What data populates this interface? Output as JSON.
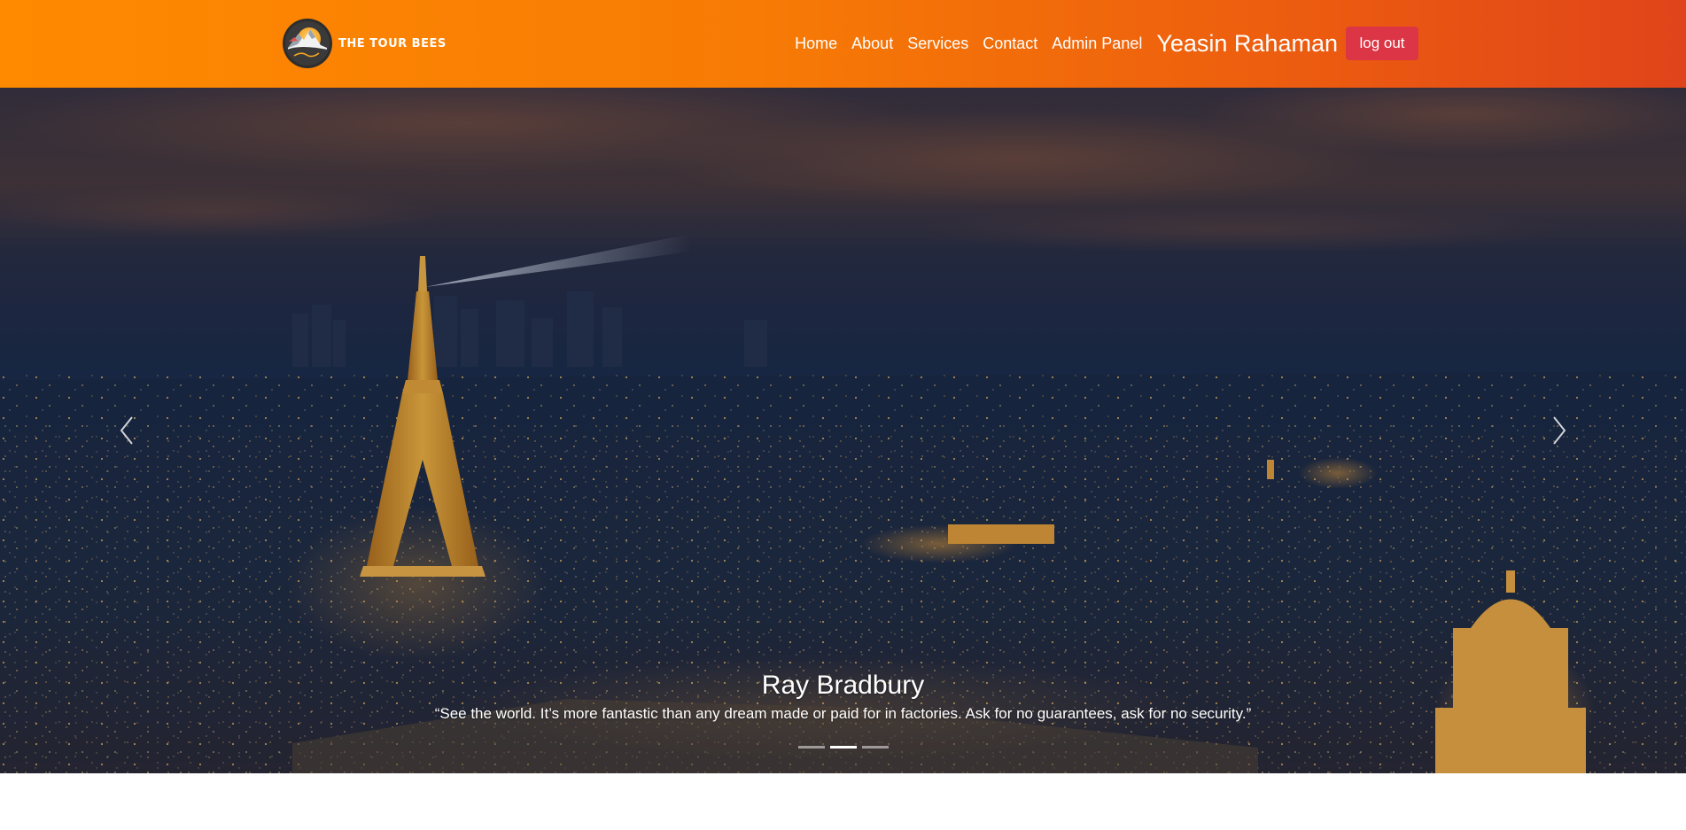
{
  "navbar": {
    "brand_name": "THE TOUR BEES",
    "links": [
      "Home",
      "About",
      "Services",
      "Contact",
      "Admin Panel"
    ],
    "user_name": "Yeasin Rahaman",
    "logout_label": "log out"
  },
  "carousel": {
    "active_index": 1,
    "slide_count": 3,
    "caption": {
      "title": "Ray Bradbury",
      "quote": "“See the world. It’s more fantastic than any dream made or paid for in factories. Ask for no guarantees, ask for no security.”"
    },
    "prev_icon": "chevron-left-icon",
    "next_icon": "chevron-right-icon"
  },
  "colors": {
    "navbar_gradient_start": "#ff8a00",
    "navbar_gradient_end": "#e0441a",
    "logout_button": "#dc3545"
  }
}
